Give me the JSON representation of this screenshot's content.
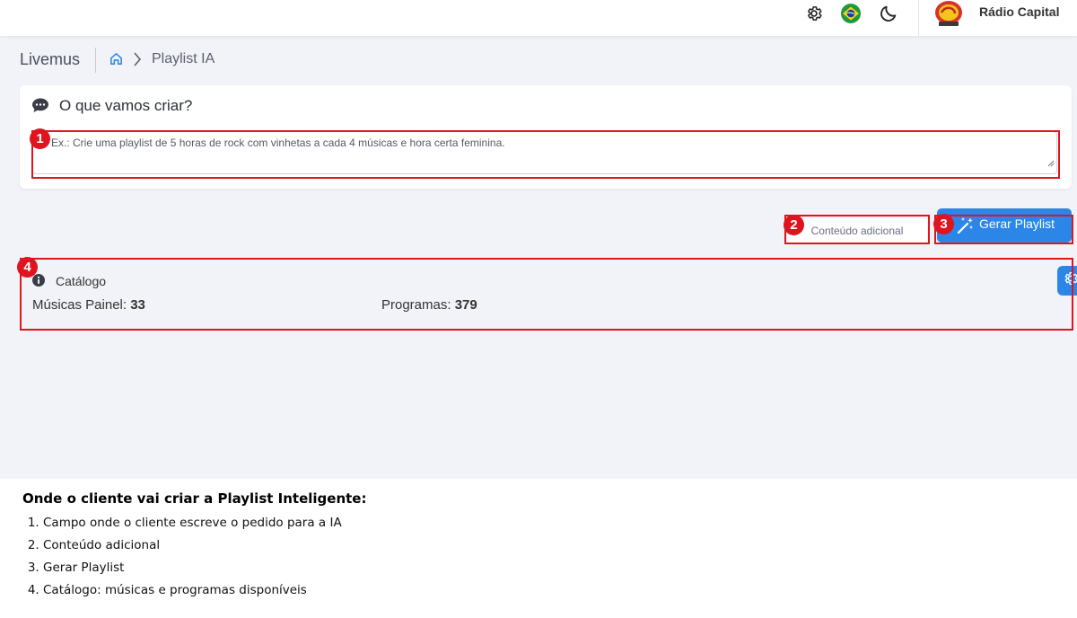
{
  "topbar": {
    "station_name": "Rádio Capital",
    "icons": [
      "gear-icon",
      "brazil-flag-icon",
      "moon-icon"
    ]
  },
  "breadcrumb": {
    "brand": "Livemus",
    "page": "Playlist IA"
  },
  "prompt_card": {
    "title": "O que vamos criar?",
    "placeholder": "Ex.: Crie uma playlist de 5 horas de rock com vinhetas a cada 4 músicas e hora certa feminina."
  },
  "actions": {
    "extra_label": "Conteúdo adicional",
    "generate_label": "Gerar Playlist"
  },
  "catalog": {
    "title": "Catálogo",
    "songs_label": "Músicas Painel:",
    "songs_value": "33",
    "programs_label": "Programas:",
    "programs_value": "379"
  },
  "callouts": [
    "1",
    "2",
    "3",
    "4"
  ],
  "notes": {
    "heading": "Onde o cliente vai criar a Playlist Inteligente:",
    "items": [
      "Campo onde o cliente escreve o pedido para a IA",
      "Conteúdo adicional",
      "Gerar Playlist",
      "Catálogo: músicas e programas disponíveis"
    ]
  },
  "colors": {
    "accent": "#2c86e8",
    "highlight": "#e0141e",
    "background": "#f2f3f9"
  }
}
